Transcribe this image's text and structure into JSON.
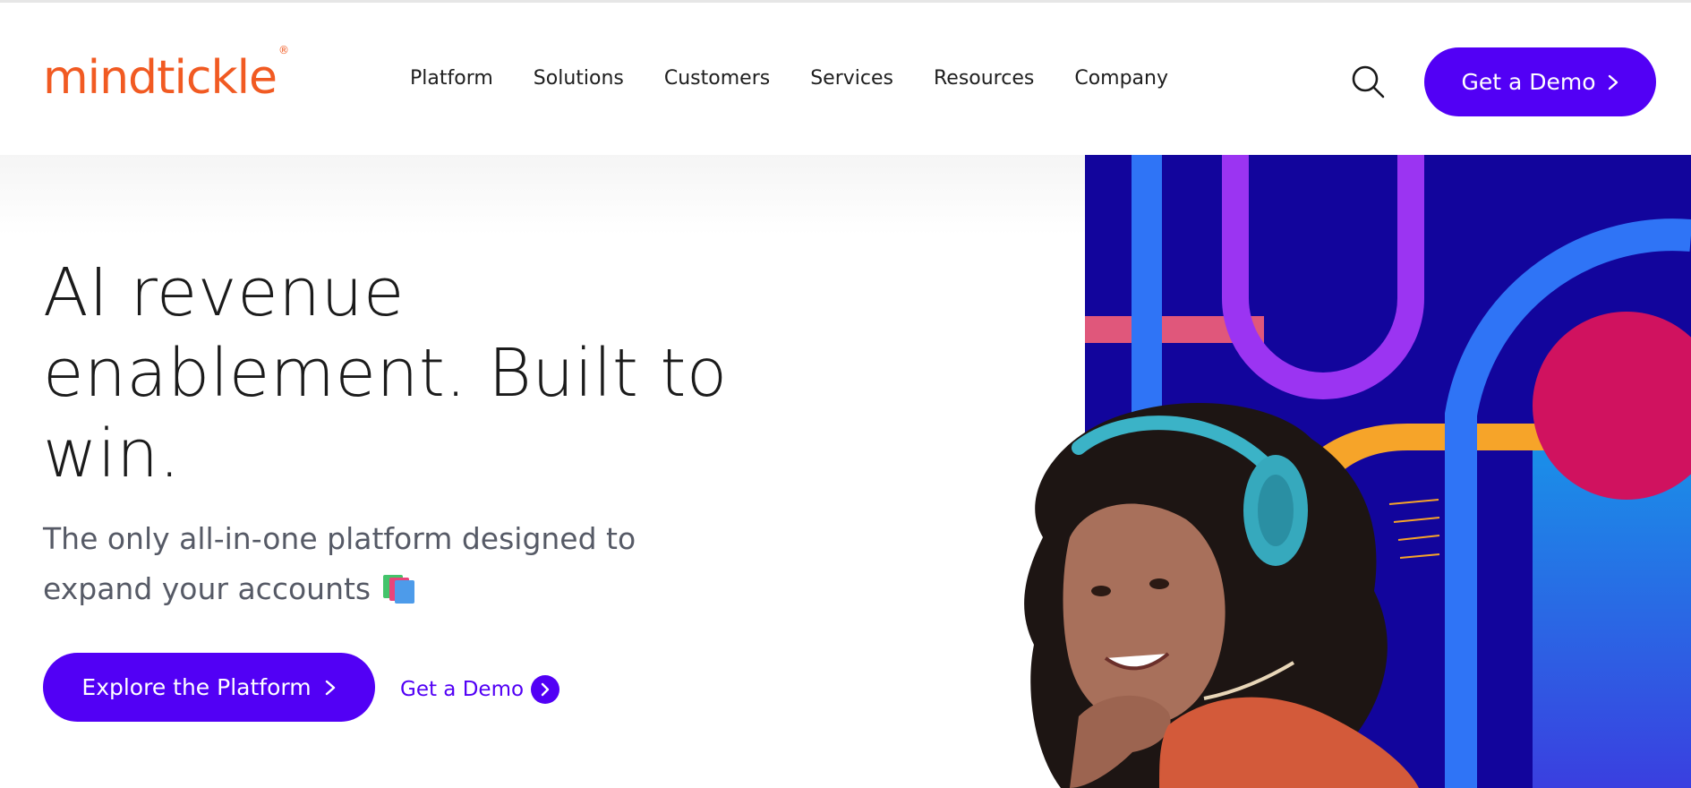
{
  "brand": {
    "logo_text": "mindtickle",
    "logo_mark": "®",
    "accent_color": "#f15a22",
    "primary_color": "#5200f5"
  },
  "nav": {
    "items": [
      {
        "label": "Platform"
      },
      {
        "label": "Solutions"
      },
      {
        "label": "Customers"
      },
      {
        "label": "Services"
      },
      {
        "label": "Resources"
      },
      {
        "label": "Company"
      }
    ],
    "search_icon": "search-icon",
    "demo_button": {
      "label": "Get a Demo",
      "icon": "chevron-right-icon"
    }
  },
  "hero": {
    "headline": "AI revenue enablement. Built to win.",
    "subheadline": "The only all-in-one platform designed to expand your accounts",
    "subheadline_icon": "books-icon",
    "primary_cta": {
      "label": "Explore the Platform",
      "icon": "chevron-right-icon"
    },
    "secondary_cta": {
      "label": "Get a Demo",
      "icon": "chevron-right-circle-icon"
    },
    "image": "woman-with-headphones-illustration"
  }
}
